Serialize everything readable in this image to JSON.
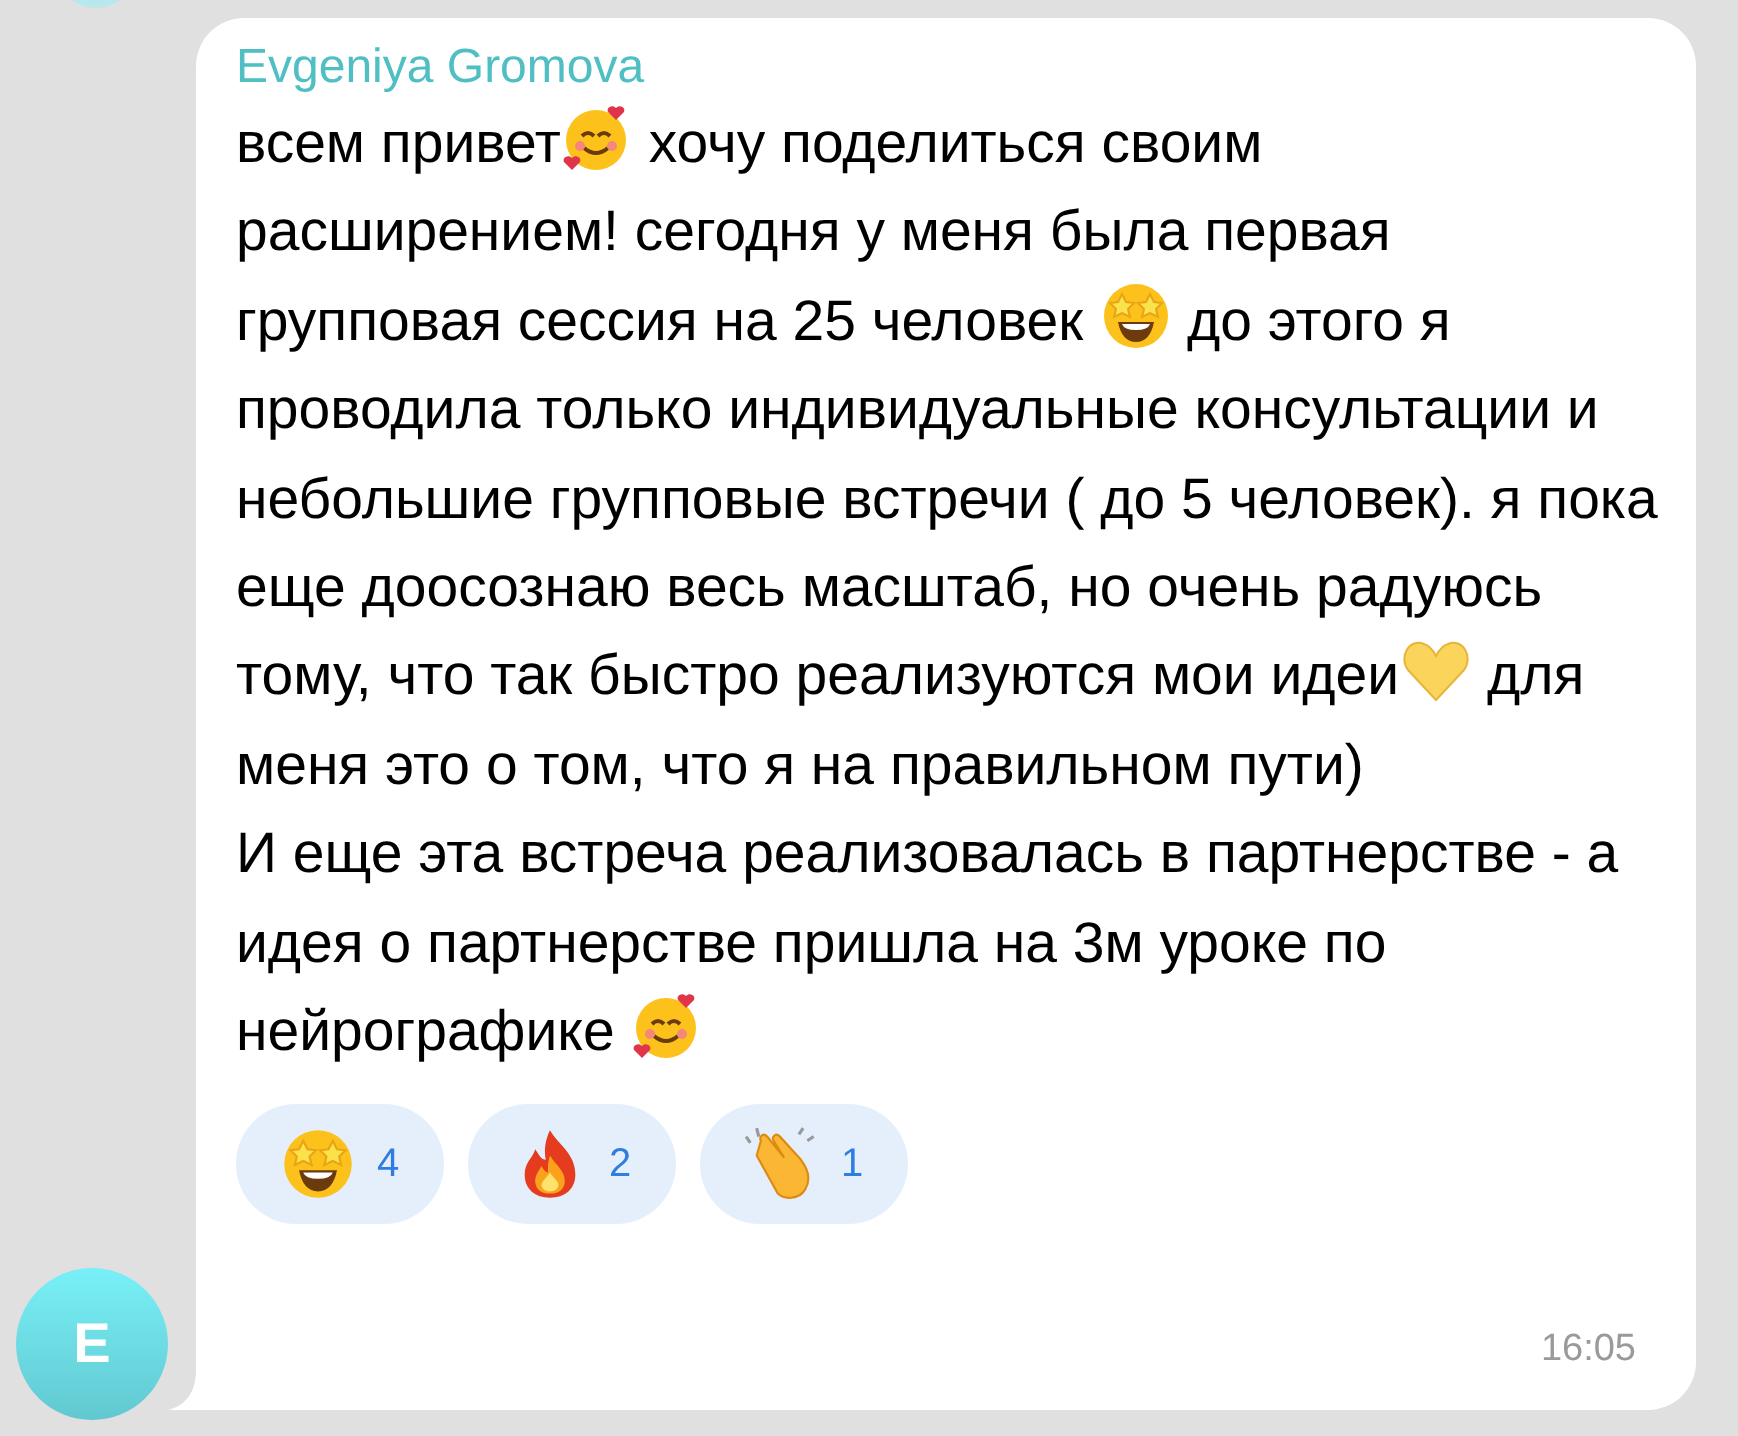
{
  "message": {
    "sender": "Evgeniya Gromova",
    "avatar_letter": "E",
    "paragraphs": [
      [
        {
          "kind": "text",
          "text": "всем привет"
        },
        {
          "kind": "hearts-face"
        },
        {
          "kind": "text",
          "text": " хочу поделиться своим расширением! сегодня у меня была первая групповая сессия на 25 человек "
        },
        {
          "kind": "star-eyes"
        },
        {
          "kind": "text",
          "text": " до этого я проводила только индивидуальные консультации и небольшие групповые встречи ( до 5 человек). я пока еще доосознаю весь масштаб, но очень радуюсь тому, что так быстро реализуются мои идеи"
        },
        {
          "kind": "heart"
        },
        {
          "kind": "text",
          "text": " для меня это о том, что я на правильном пути)"
        }
      ],
      [
        {
          "kind": "text",
          "text": "И еще эта встреча реализовалась в партнерстве - а идея о партнерстве пришла на 3м уроке по нейрографике "
        },
        {
          "kind": "hearts-face"
        }
      ]
    ],
    "reactions": [
      {
        "kind": "star-eyes",
        "count": "4"
      },
      {
        "kind": "fire",
        "count": "2"
      },
      {
        "kind": "clap",
        "count": "1"
      }
    ],
    "time": "16:05"
  }
}
